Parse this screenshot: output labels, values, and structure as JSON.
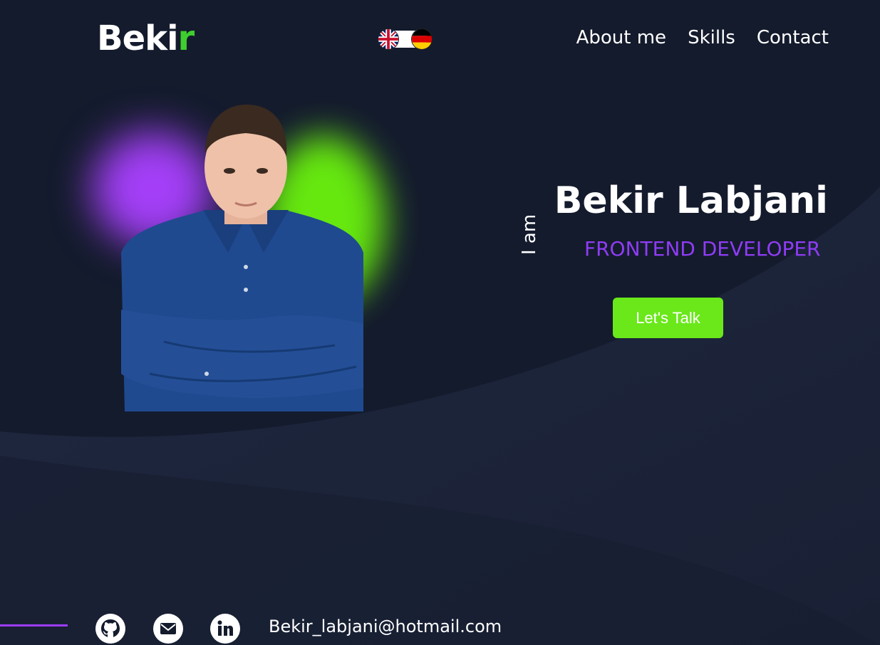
{
  "header": {
    "logo_main": "Beki",
    "logo_accent": "r",
    "nav": [
      {
        "label": "About me"
      },
      {
        "label": "Skills"
      },
      {
        "label": "Contact"
      }
    ],
    "language_toggle": {
      "options": [
        "uk-flag-icon",
        "germany-flag-icon"
      ]
    }
  },
  "hero": {
    "intro": "I am",
    "name": "Bekir Labjani",
    "role": "FRONTEND DEVELOPER",
    "cta_label": "Let's Talk"
  },
  "footer": {
    "icons": [
      "github-icon",
      "mail-icon",
      "linkedin-icon"
    ],
    "email": "Bekir_labjani@hotmail.com"
  },
  "colors": {
    "background": "#141b2d",
    "accent_green": "#6ae81a",
    "accent_purple": "#8f3cf5",
    "logo_accent": "#3ecf2e"
  }
}
